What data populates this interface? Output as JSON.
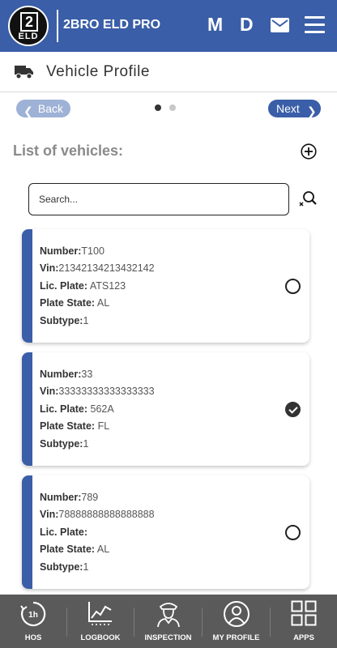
{
  "header": {
    "logo_text": "2",
    "logo_sub": "ELD",
    "app_title": "2BRO ELD PRO",
    "letter_m": "M",
    "letter_d": "D",
    "bg_color": "#3a5ea7"
  },
  "page": {
    "title": "Vehicle Profile",
    "icon": "truck-icon"
  },
  "pager": {
    "back_label": "Back",
    "next_label": "Next",
    "current_page": 1,
    "total_pages": 2
  },
  "list": {
    "title": "List of vehicles:"
  },
  "search": {
    "placeholder": "Search..."
  },
  "labels": {
    "number": "Number:",
    "vin": "Vin:",
    "plate": "Lic. Plate:",
    "state": "Plate State:",
    "subtype": "Subtype:"
  },
  "vehicles": [
    {
      "number": "T100",
      "vin": "21342134213432142",
      "plate": "ATS123",
      "state": "AL",
      "subtype": "1",
      "selected": false
    },
    {
      "number": "33",
      "vin": "33333333333333333",
      "plate": "562A",
      "state": "FL",
      "subtype": "1",
      "selected": true
    },
    {
      "number": "789",
      "vin": "78888888888888888",
      "plate": "",
      "state": "AL",
      "subtype": "1",
      "selected": false
    }
  ],
  "nav": {
    "hos": "HOS",
    "hos_icon_text": "1h",
    "logbook": "LOGBOOK",
    "inspection": "INSPECTION",
    "profile": "MY PROFILE",
    "apps": "APPS"
  }
}
